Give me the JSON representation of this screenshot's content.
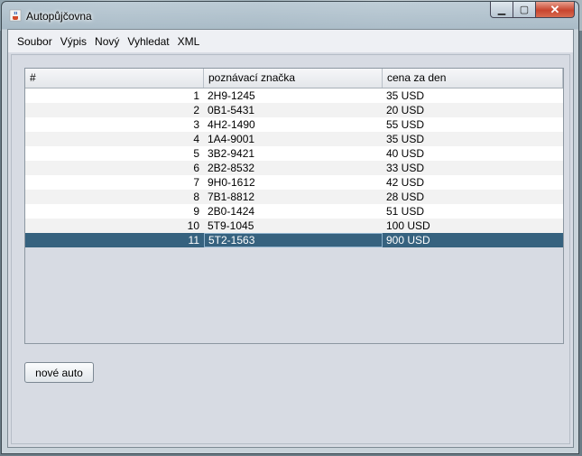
{
  "window": {
    "title": "Autopůjčovna"
  },
  "menu": [
    "Soubor",
    "Výpis",
    "Nový",
    "Vyhledat",
    "XML"
  ],
  "table": {
    "columns": [
      "#",
      "poznávací značka",
      "cena za den"
    ],
    "rows": [
      [
        "1",
        "2H9-1245",
        "35 USD"
      ],
      [
        "2",
        "0B1-5431",
        "20 USD"
      ],
      [
        "3",
        "4H2-1490",
        "55 USD"
      ],
      [
        "4",
        "1A4-9001",
        "35 USD"
      ],
      [
        "5",
        "3B2-9421",
        "40 USD"
      ],
      [
        "6",
        "2B2-8532",
        "33 USD"
      ],
      [
        "7",
        "9H0-1612",
        "42 USD"
      ],
      [
        "8",
        "7B1-8812",
        "28 USD"
      ],
      [
        "9",
        "2B0-1424",
        "51 USD"
      ],
      [
        "10",
        "5T9-1045",
        "100 USD"
      ],
      [
        "11",
        "5T2-1563",
        "900 USD"
      ]
    ],
    "selected_row": "11"
  },
  "buttons": {
    "new_car": "nové auto"
  },
  "colors": {
    "selection": "#36627f",
    "close_button": "#c8452e"
  },
  "icons": {
    "app": "java-coffee-cup-icon"
  }
}
